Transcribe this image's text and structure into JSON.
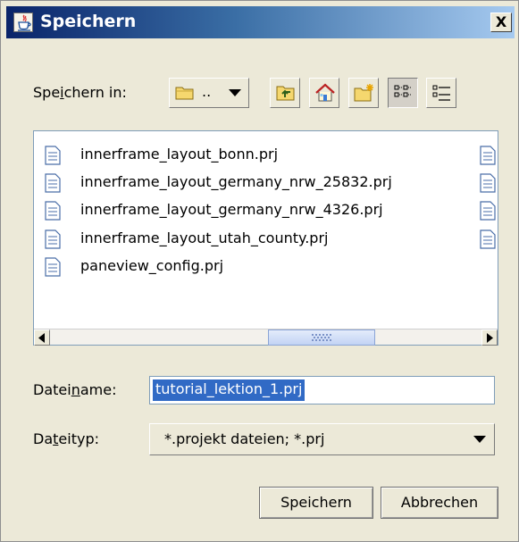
{
  "window": {
    "title": "Speichern",
    "close_label": "X",
    "app_icon": "java-cup-icon"
  },
  "save_in": {
    "label_before": "Spe",
    "label_mnemonic": "i",
    "label_after": "chern in:",
    "folder_value": ".."
  },
  "toolbar": {
    "icons": [
      "up-one-level-icon",
      "home-icon",
      "new-folder-icon",
      "list-view-icon",
      "details-view-icon"
    ],
    "selected": "list-view-icon"
  },
  "files": [
    "innerframe_layout_bonn.prj",
    "innerframe_layout_germany_nrw_25832.prj",
    "innerframe_layout_germany_nrw_4326.prj",
    "innerframe_layout_utah_county.prj",
    "paneview_config.prj"
  ],
  "filename": {
    "label_before": "Datei",
    "label_mnemonic": "n",
    "label_after": "ame:",
    "value": "tutorial_lektion_1.prj"
  },
  "filetype": {
    "label_before": "Da",
    "label_mnemonic": "t",
    "label_after": "eityp:",
    "value": "*.projekt dateien; *.prj"
  },
  "buttons": {
    "save": "Speichern",
    "cancel": "Abbrechen"
  }
}
